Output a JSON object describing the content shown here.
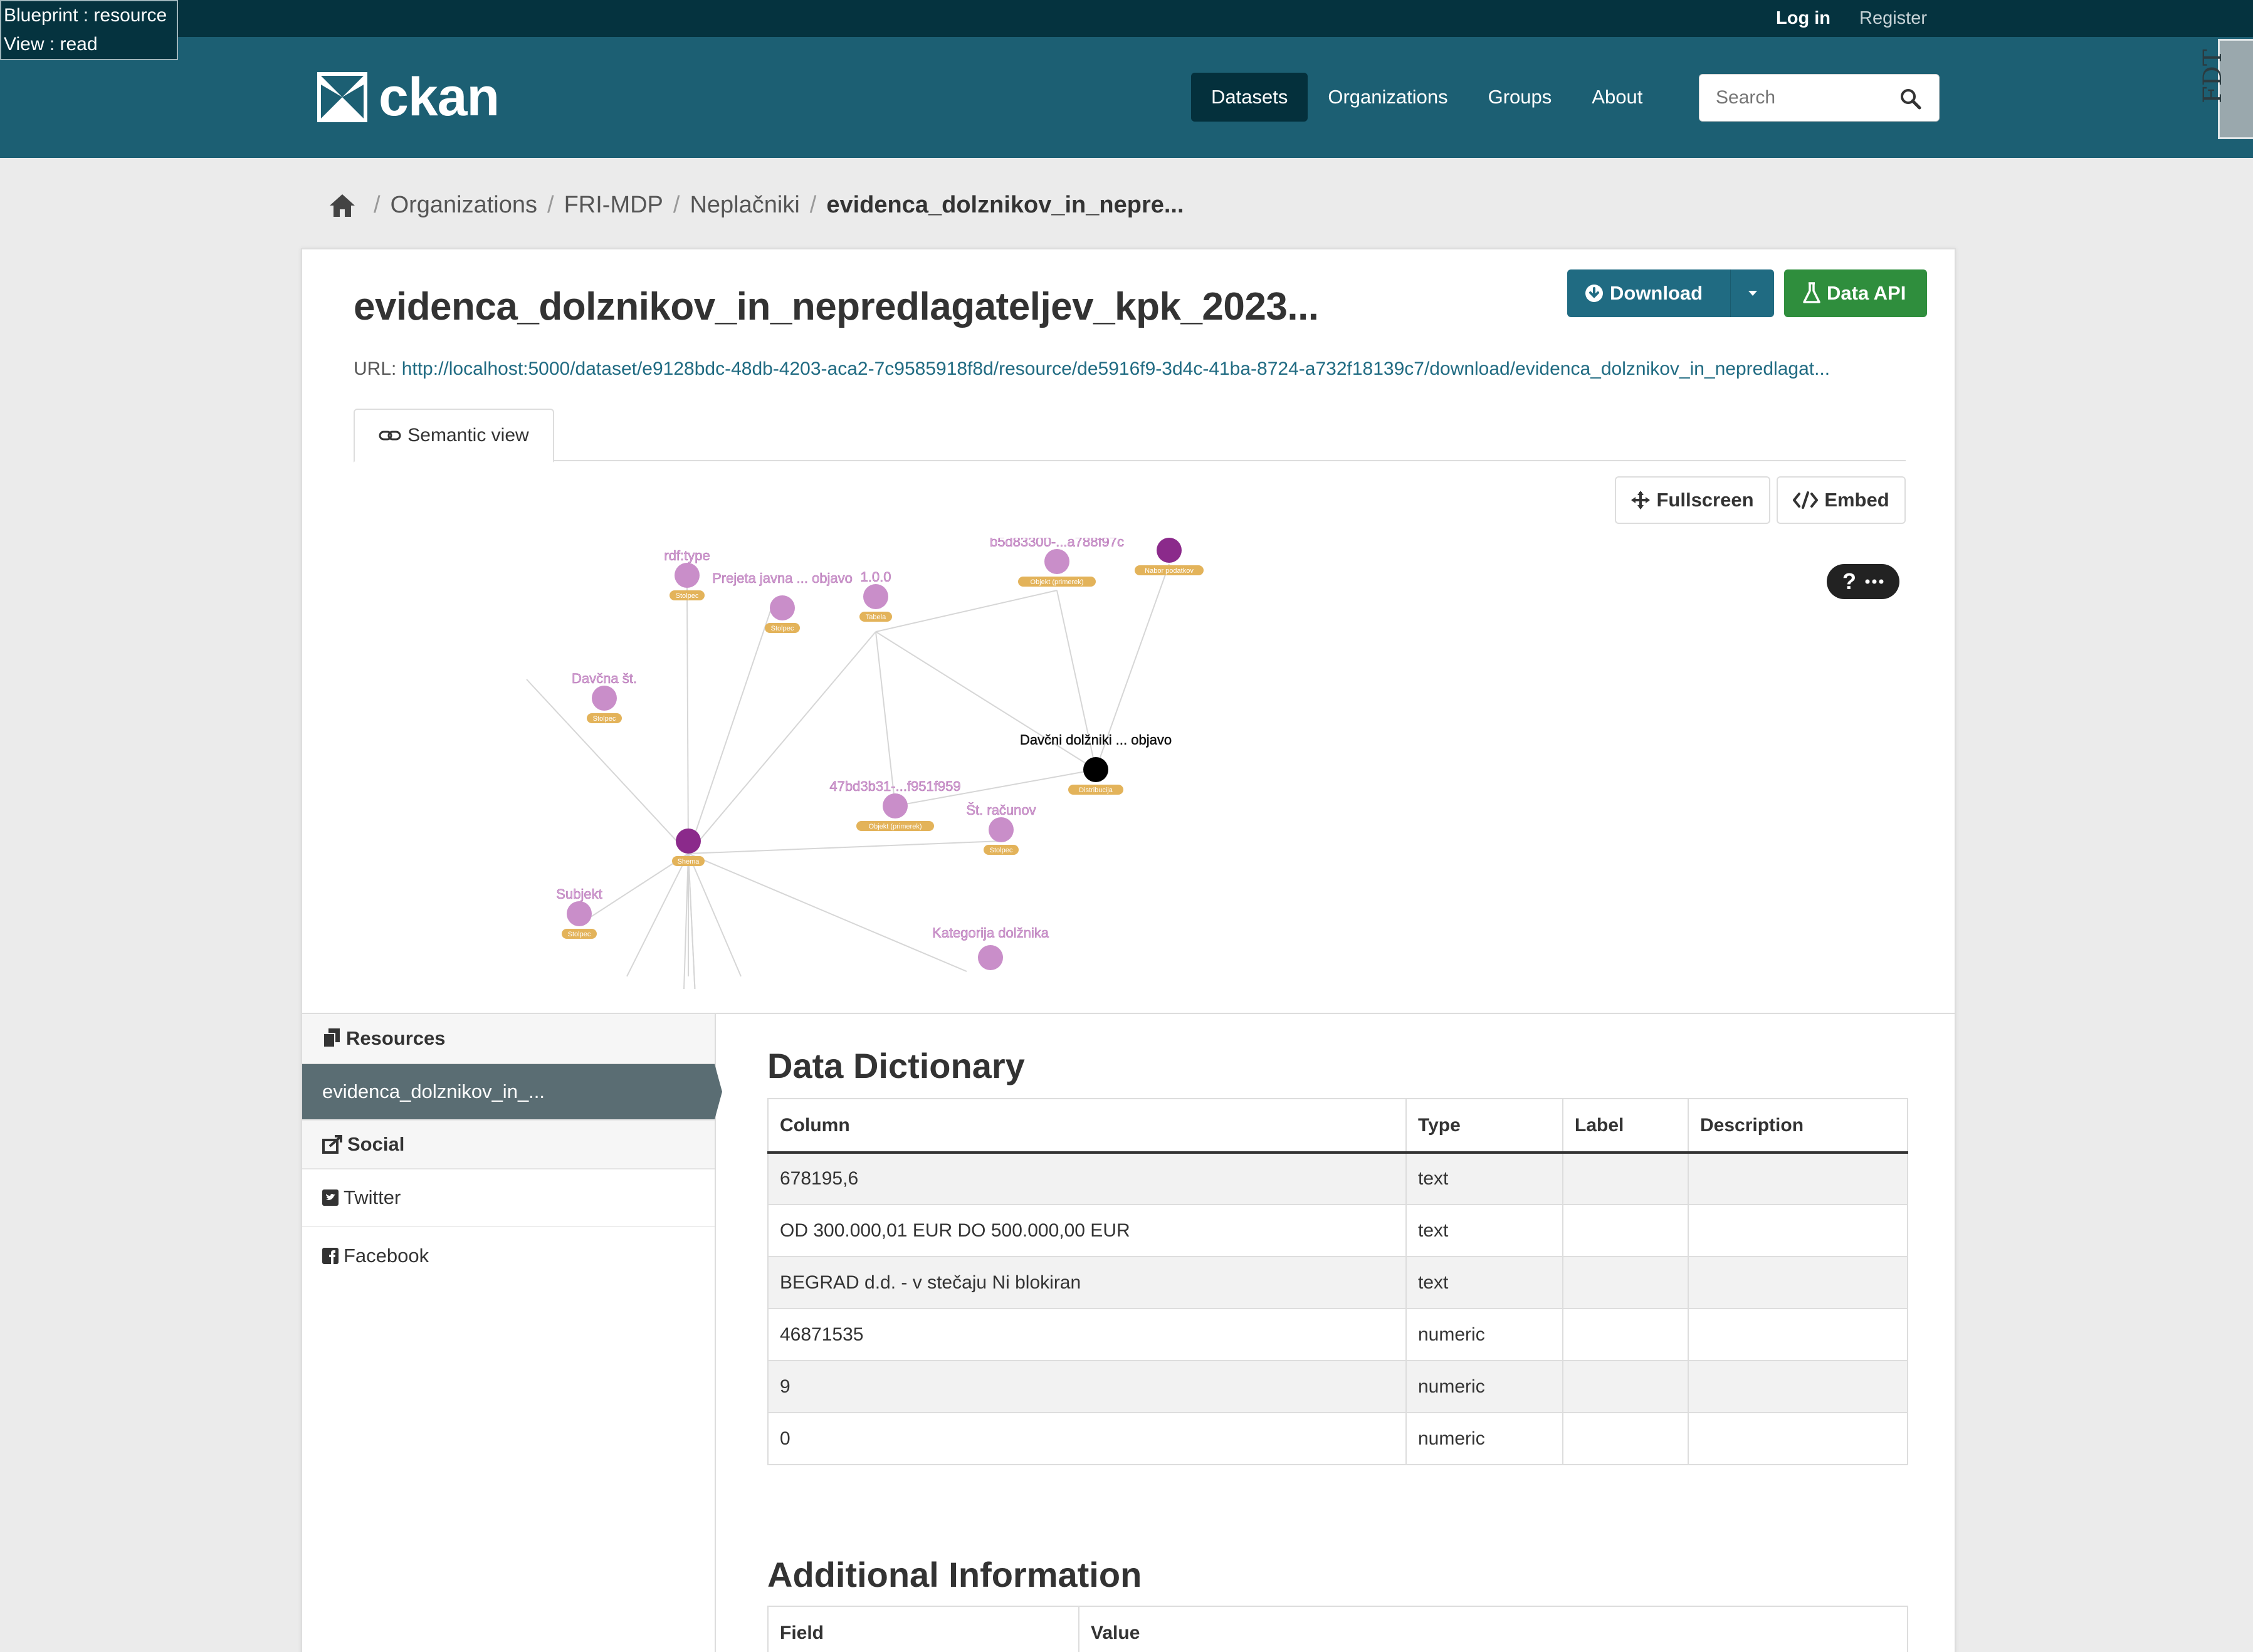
{
  "debug": {
    "blueprint": "Blueprint : resource",
    "view": "View : read"
  },
  "account": {
    "login": "Log in",
    "register": "Register"
  },
  "brand": {
    "name": "ckan"
  },
  "nav": {
    "items": [
      "Datasets",
      "Organizations",
      "Groups",
      "About"
    ],
    "active": "Datasets"
  },
  "search": {
    "placeholder": "Search"
  },
  "side_tab": {
    "label": "FDT"
  },
  "breadcrumb": {
    "items": [
      "Organizations",
      "FRI-MDP",
      "Neplačniki",
      "evidenca_dolznikov_in_nepre..."
    ]
  },
  "resource": {
    "title": "evidenca_dolznikov_in_nepredlagateljev_kpk_2023...",
    "url_label": "URL:",
    "url": "http://localhost:5000/dataset/e9128bdc-48db-4203-aca2-7c9585918f8d/resource/de5916f9-3d4c-41ba-8724-a732f18139c7/download/evidenca_dolznikov_in_nepredlagat..."
  },
  "actions": {
    "download": "Download",
    "data_api": "Data API",
    "fullscreen": "Fullscreen",
    "embed": "Embed"
  },
  "view_tab": {
    "label": "Semantic view"
  },
  "graph": {
    "help": "?",
    "nodes": [
      {
        "label": "rdf:type",
        "tag": "Stolpec"
      },
      {
        "label": "Prejeta javna ... objavo",
        "tag": "Stolpec"
      },
      {
        "label": "1.0.0",
        "tag": "Tabela"
      },
      {
        "label": "b5d83300-...a788f97c",
        "tag": "Objekt (primerek)"
      },
      {
        "label": "",
        "tag": "Nabor podatkov"
      },
      {
        "label": "Davčna št.",
        "tag": "Stolpec"
      },
      {
        "label": "Davčni dolžniki ... objavo",
        "tag": "Distribucija"
      },
      {
        "label": "47bd3b31-...f951f959",
        "tag": "Objekt (primerek)"
      },
      {
        "label": "Št. računov",
        "tag": "Stolpec"
      },
      {
        "label": "",
        "tag": "Shema"
      },
      {
        "label": "Subjekt",
        "tag": "Stolpec"
      },
      {
        "label": "Kategorija dolžnika",
        "tag": ""
      }
    ]
  },
  "sidebar": {
    "resources_title": "Resources",
    "resource_item": "evidenca_dolznikov_in_...",
    "social_title": "Social",
    "twitter": "Twitter",
    "facebook": "Facebook"
  },
  "data_dictionary": {
    "title": "Data Dictionary",
    "headers": [
      "Column",
      "Type",
      "Label",
      "Description"
    ],
    "rows": [
      [
        "678195,6",
        "text",
        "",
        ""
      ],
      [
        "OD 300.000,01 EUR DO 500.000,00 EUR",
        "text",
        "",
        ""
      ],
      [
        "BEGRAD d.d. - v stečaju Ni blokiran",
        "text",
        "",
        ""
      ],
      [
        "46871535",
        "numeric",
        "",
        ""
      ],
      [
        "9",
        "numeric",
        "",
        ""
      ],
      [
        "0",
        "numeric",
        "",
        ""
      ]
    ]
  },
  "additional_info": {
    "title": "Additional Information",
    "headers": [
      "Field",
      "Value"
    ]
  },
  "colors": {
    "topbar": "#05333f",
    "masthead": "#1c5f73",
    "primary": "#206b82",
    "success": "#2f8e3d",
    "node": "#c98ec9",
    "node_dark": "#8b2a8b",
    "tag": "#e3b35a"
  }
}
